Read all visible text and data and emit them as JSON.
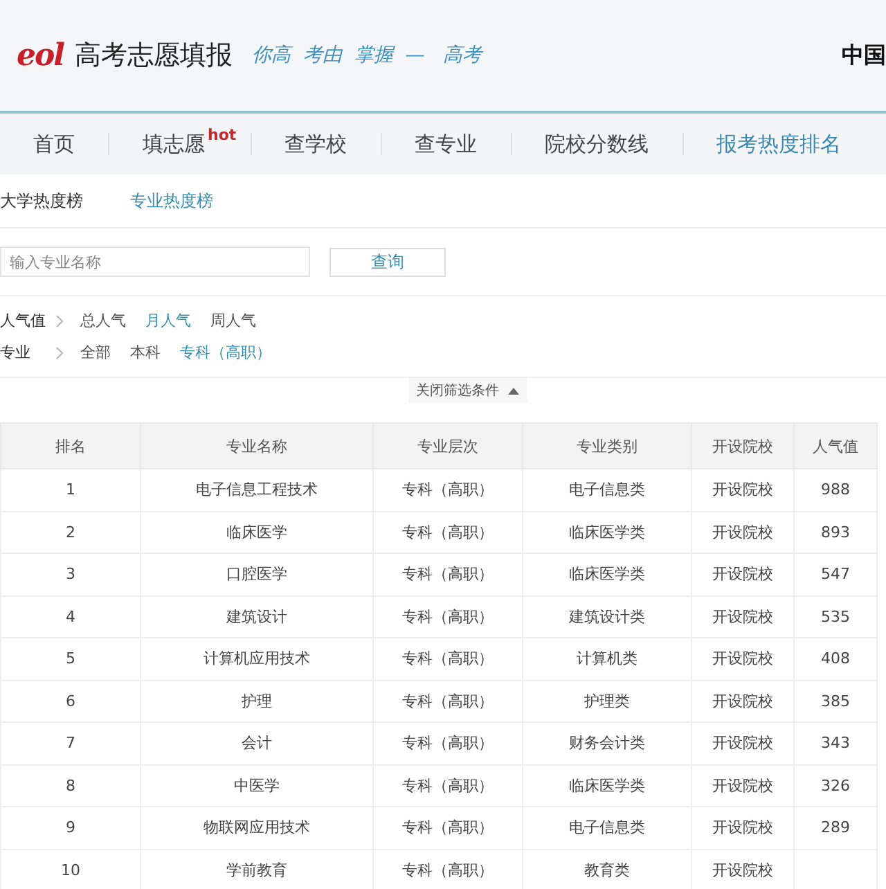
{
  "header": {
    "logo": "eol",
    "title": "高考志愿填报",
    "slogan": "你高  考由  掌握  —   高考",
    "right_text": "中国"
  },
  "nav": [
    {
      "label": "首页",
      "selected": false
    },
    {
      "label": "填志愿",
      "badge": "hot",
      "selected": false
    },
    {
      "label": "查学校",
      "selected": false
    },
    {
      "label": "查专业",
      "selected": false
    },
    {
      "label": "院校分数线",
      "selected": false
    },
    {
      "label": "报考热度排名",
      "selected": true
    }
  ],
  "subtabs": [
    {
      "label": "大学热度榜",
      "selected": false
    },
    {
      "label": "专业热度榜",
      "selected": true
    }
  ],
  "search": {
    "placeholder": "输入专业名称",
    "button": "查询"
  },
  "filters": [
    {
      "label": "人气值",
      "options": [
        {
          "label": "总人气",
          "selected": false
        },
        {
          "label": "月人气",
          "selected": true
        },
        {
          "label": "周人气",
          "selected": false
        }
      ]
    },
    {
      "label": "专业",
      "options": [
        {
          "label": "全部",
          "selected": false
        },
        {
          "label": "本科",
          "selected": false
        },
        {
          "label": "专科（高职）",
          "selected": true
        }
      ]
    }
  ],
  "toggle": "关闭筛选条件",
  "table": {
    "columns": [
      "排名",
      "专业名称",
      "专业层次",
      "专业类别",
      "开设院校",
      "人气值"
    ],
    "rows": [
      [
        "1",
        "电子信息工程技术",
        "专科（高职）",
        "电子信息类",
        "开设院校",
        "988"
      ],
      [
        "2",
        "临床医学",
        "专科（高职）",
        "临床医学类",
        "开设院校",
        "893"
      ],
      [
        "3",
        "口腔医学",
        "专科（高职）",
        "临床医学类",
        "开设院校",
        "547"
      ],
      [
        "4",
        "建筑设计",
        "专科（高职）",
        "建筑设计类",
        "开设院校",
        "535"
      ],
      [
        "5",
        "计算机应用技术",
        "专科（高职）",
        "计算机类",
        "开设院校",
        "408"
      ],
      [
        "6",
        "护理",
        "专科（高职）",
        "护理类",
        "开设院校",
        "385"
      ],
      [
        "7",
        "会计",
        "专科（高职）",
        "财务会计类",
        "开设院校",
        "343"
      ],
      [
        "8",
        "中医学",
        "专科（高职）",
        "临床医学类",
        "开设院校",
        "326"
      ],
      [
        "9",
        "物联网应用技术",
        "专科（高职）",
        "电子信息类",
        "开设院校",
        "289"
      ],
      [
        "10",
        "学前教育",
        "专科（高职）",
        "教育类",
        "开设院校"
      ]
    ]
  }
}
